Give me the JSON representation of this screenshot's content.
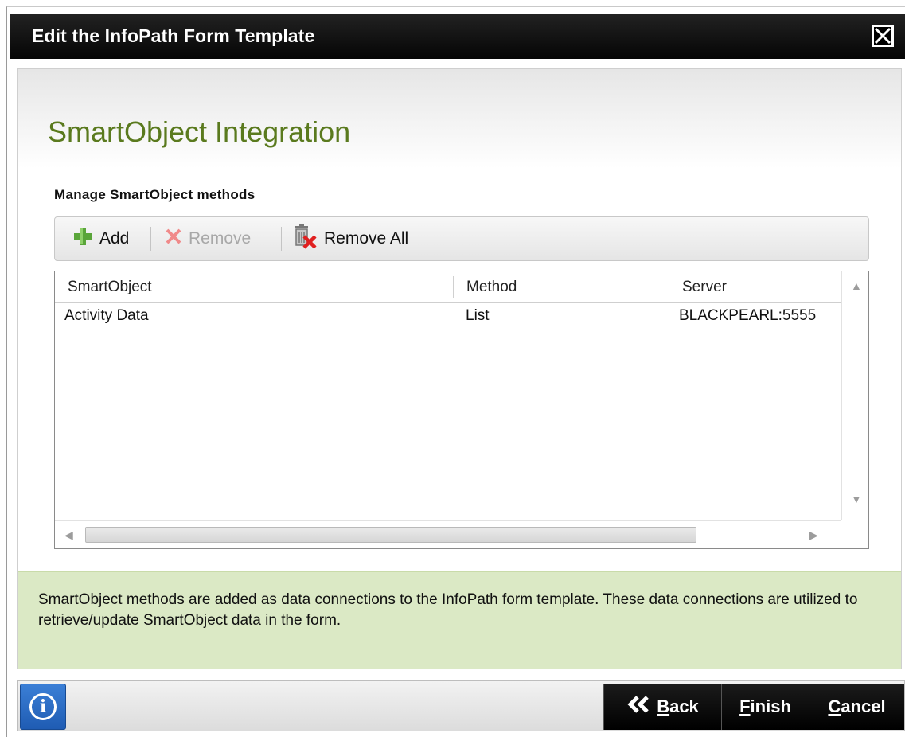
{
  "window": {
    "title": "Edit the InfoPath Form Template"
  },
  "page": {
    "heading": "SmartObject Integration",
    "subheading": "Manage SmartObject methods"
  },
  "toolbar": {
    "add_label": "Add",
    "remove_label": "Remove",
    "remove_all_label": "Remove All"
  },
  "grid": {
    "columns": [
      "SmartObject",
      "Method",
      "Server"
    ],
    "rows": [
      {
        "smartobject": "Activity Data",
        "method": "List",
        "server": "BLACKPEARL:5555"
      }
    ]
  },
  "info": {
    "text": "SmartObject methods are added as data connections to the InfoPath form template. These data connections are utilized to retrieve/update SmartObject data in the form."
  },
  "footer": {
    "back_first": "B",
    "back_rest": "ack",
    "finish_first": "F",
    "finish_rest": "inish",
    "cancel_first": "C",
    "cancel_rest": "ancel"
  },
  "colors": {
    "heading": "#5a7a1e",
    "info_bg": "#dbe9c5",
    "titlebar": "#000000",
    "info_button": "#2a6cc4"
  },
  "icons": [
    "close-icon",
    "add-icon",
    "remove-icon",
    "remove-all-icon",
    "info-icon",
    "back-arrow-icon"
  ]
}
